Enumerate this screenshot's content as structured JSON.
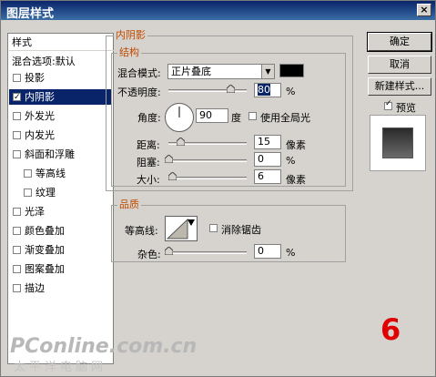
{
  "window": {
    "title": "图层样式",
    "close_glyph": "×"
  },
  "left_panel": {
    "header": "样式",
    "blend_options": "混合选项:默认",
    "items": [
      {
        "label": "投影",
        "checked": false,
        "indent": 0
      },
      {
        "label": "内阴影",
        "checked": true,
        "indent": 0,
        "selected": true
      },
      {
        "label": "外发光",
        "checked": false,
        "indent": 0
      },
      {
        "label": "内发光",
        "checked": false,
        "indent": 0
      },
      {
        "label": "斜面和浮雕",
        "checked": false,
        "indent": 0
      },
      {
        "label": "等高线",
        "checked": false,
        "indent": 1
      },
      {
        "label": "纹理",
        "checked": false,
        "indent": 1
      },
      {
        "label": "光泽",
        "checked": false,
        "indent": 0
      },
      {
        "label": "颜色叠加",
        "checked": false,
        "indent": 0
      },
      {
        "label": "渐变叠加",
        "checked": false,
        "indent": 0
      },
      {
        "label": "图案叠加",
        "checked": false,
        "indent": 0
      },
      {
        "label": "描边",
        "checked": false,
        "indent": 0
      }
    ]
  },
  "inner_shadow": {
    "section_title": "内阴影",
    "structure_title": "结构",
    "blend_mode_label": "混合模式:",
    "blend_mode_value": "正片叠底",
    "blend_color": "#000000",
    "opacity_label": "不透明度:",
    "opacity_value": "80",
    "opacity_unit": "%",
    "angle_label": "角度:",
    "angle_value": "90",
    "angle_unit": "度",
    "global_light_label": "使用全局光",
    "global_light_checked": false,
    "distance_label": "距离:",
    "distance_value": "15",
    "distance_unit": "像素",
    "choke_label": "阻塞:",
    "choke_value": "0",
    "choke_unit": "%",
    "size_label": "大小:",
    "size_value": "6",
    "size_unit": "像素"
  },
  "quality": {
    "title": "品质",
    "contour_label": "等高线:",
    "antialias_label": "消除锯齿",
    "antialias_checked": false,
    "noise_label": "杂色:",
    "noise_value": "0",
    "noise_unit": "%"
  },
  "buttons": {
    "ok": "确定",
    "cancel": "取消",
    "new_style": "新建样式...",
    "preview_label": "预览",
    "preview_checked": true
  },
  "annotation": {
    "step_number": "6"
  },
  "watermark": {
    "line1": "PConline.com.cn",
    "line2": "太平洋电脑网"
  }
}
